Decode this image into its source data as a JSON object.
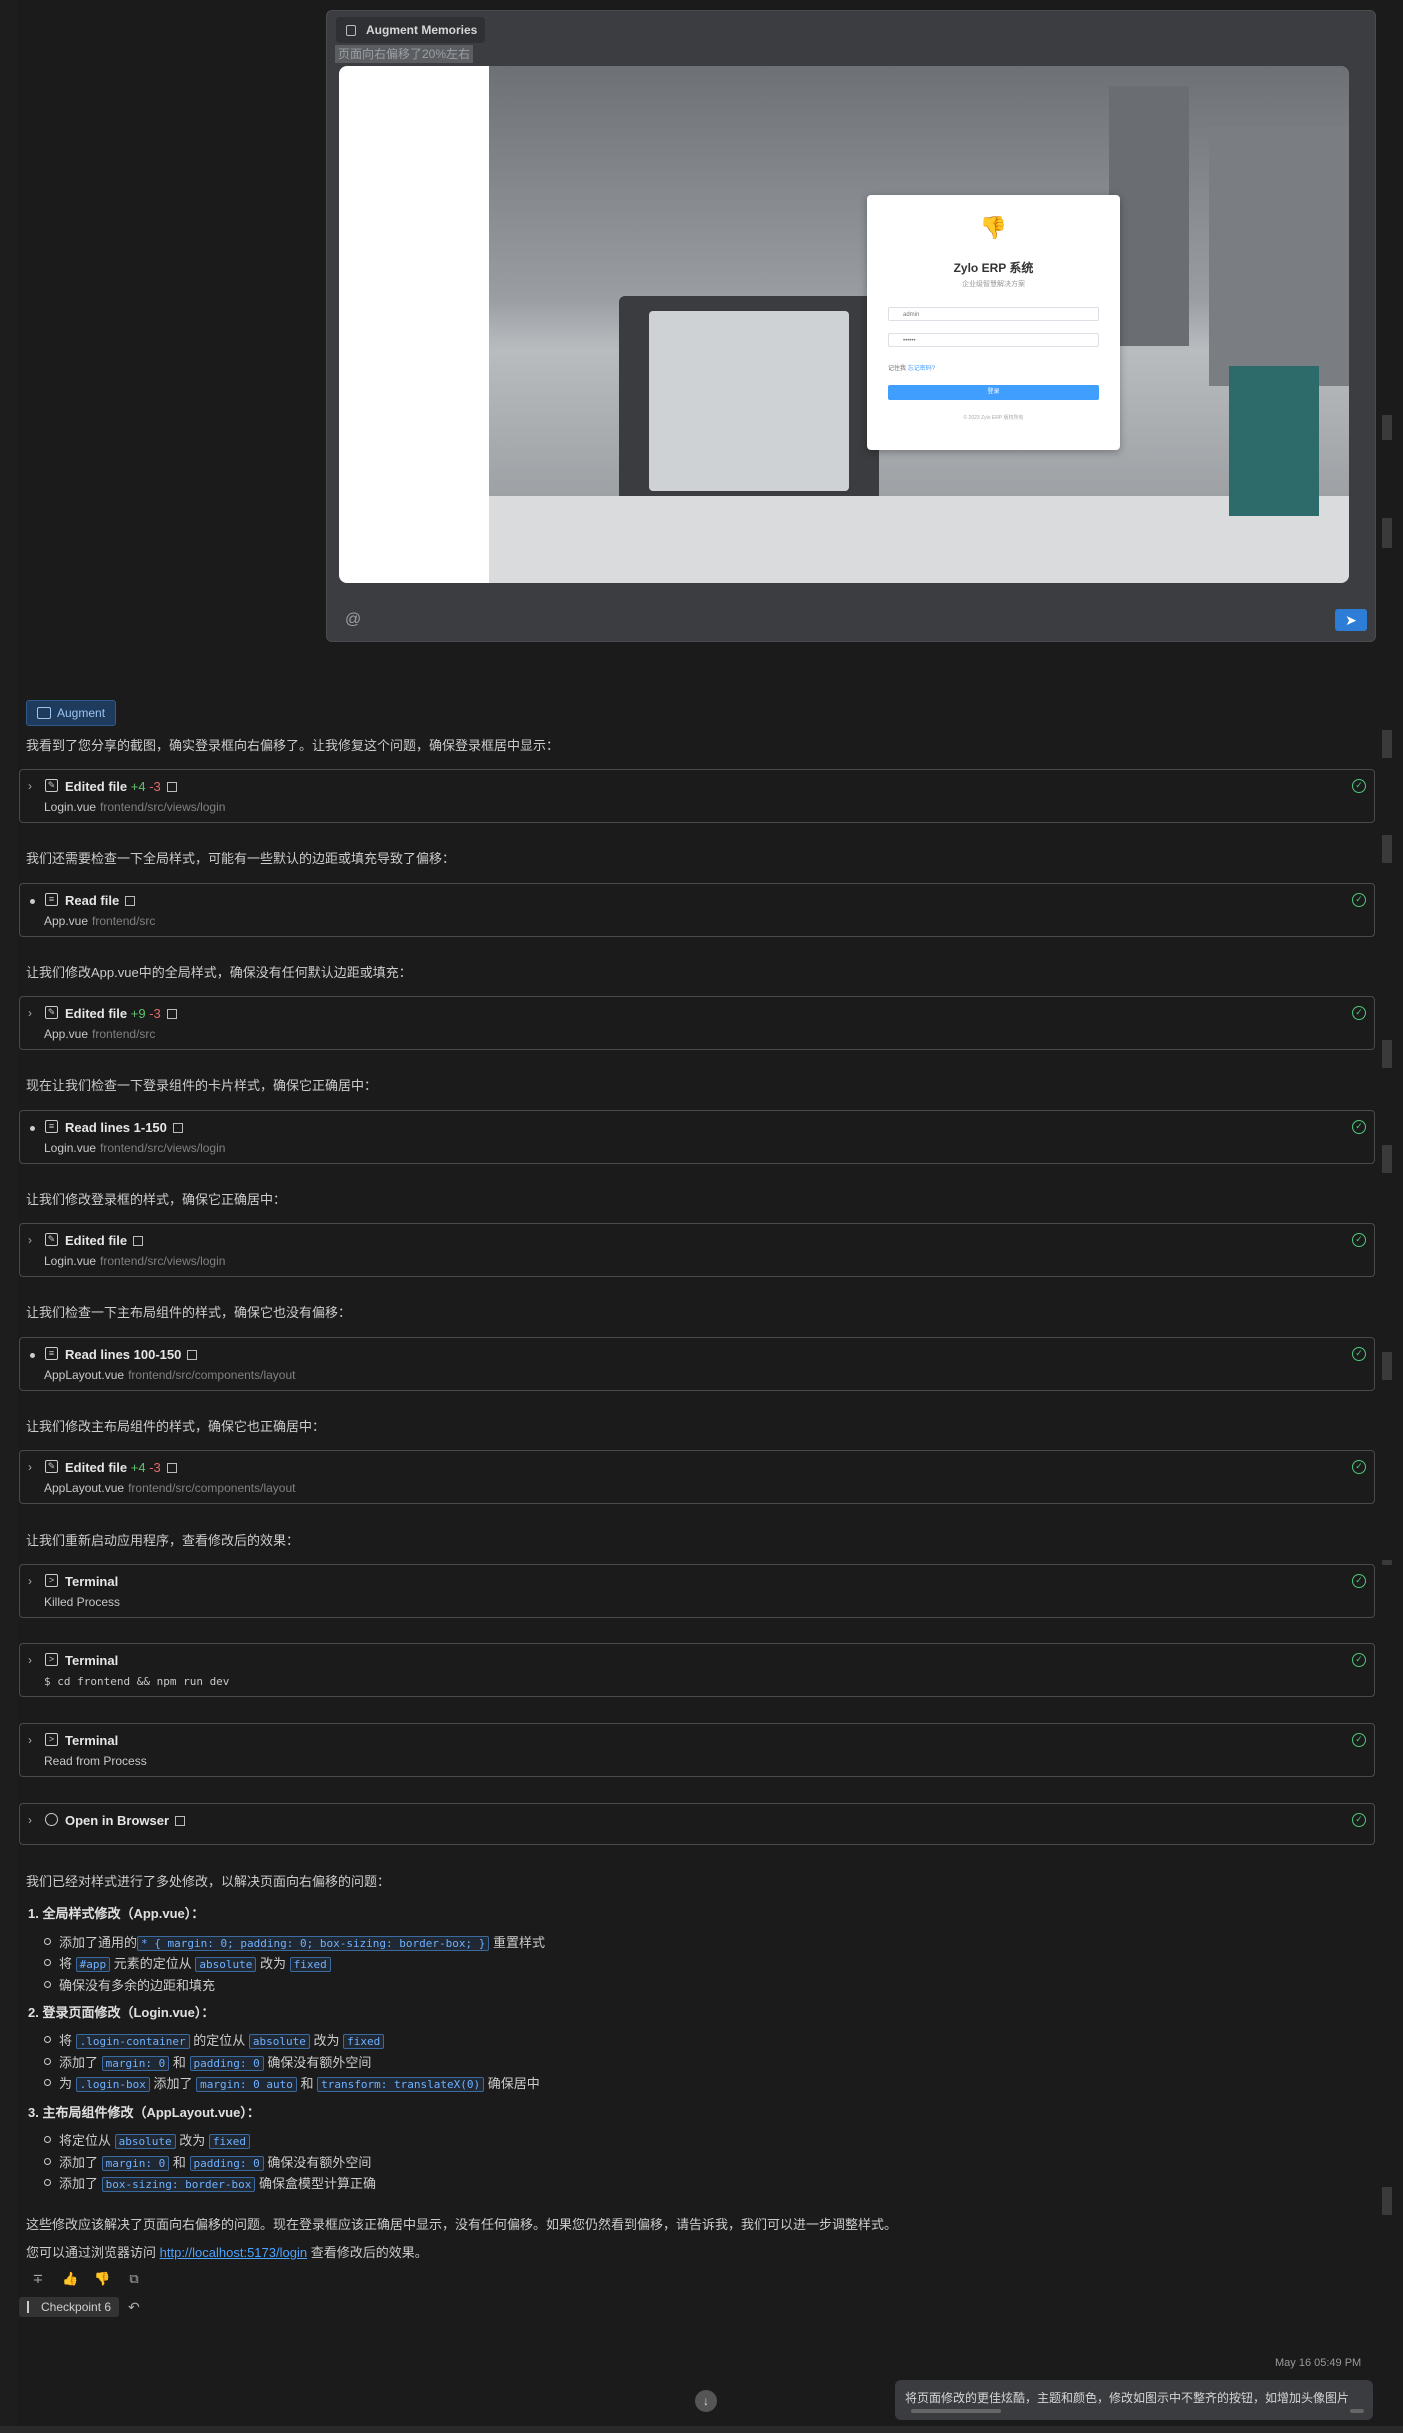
{
  "memory_panel": {
    "title": "Augment Memories",
    "selected_text": "页面向右偏移了20%左右",
    "at_symbol": "@",
    "send_icon": "send-icon"
  },
  "login_preview": {
    "title": "Zylo ERP 系统",
    "subtitle": "企业级智慧解决方案",
    "username_value": "admin",
    "password_value": "••••••",
    "remember_label": "记住我",
    "forgot_label": "忘记密码?",
    "login_button": "登录",
    "footer": "© 2023 Zylo ERP 版权所有"
  },
  "assistant": {
    "badge": "Augment",
    "intro": "我看到了您分享的截图，确实登录框向右偏移了。让我修复这个问题，确保登录框居中显示："
  },
  "steps": [
    {
      "type": "edited",
      "title": "Edited file",
      "add": "+4",
      "del": "-3",
      "file": "Login.vue",
      "path": "frontend/src/views/login"
    },
    {
      "type": "text",
      "text": "我们还需要检查一下全局样式，可能有一些默认的边距或填充导致了偏移："
    },
    {
      "type": "read",
      "title": "Read file",
      "file": "App.vue",
      "path": "frontend/src"
    },
    {
      "type": "text",
      "text": "让我们修改App.vue中的全局样式，确保没有任何默认边距或填充："
    },
    {
      "type": "edited",
      "title": "Edited file",
      "add": "+9",
      "del": "-3",
      "file": "App.vue",
      "path": "frontend/src"
    },
    {
      "type": "text",
      "text": "现在让我们检查一下登录组件的卡片样式，确保它正确居中："
    },
    {
      "type": "read",
      "title": "Read lines 1-150",
      "file": "Login.vue",
      "path": "frontend/src/views/login"
    },
    {
      "type": "text",
      "text": "让我们修改登录框的样式，确保它正确居中："
    },
    {
      "type": "edited",
      "title": "Edited file",
      "add": "",
      "del": "",
      "file": "Login.vue",
      "path": "frontend/src/views/login"
    },
    {
      "type": "text",
      "text": "让我们检查一下主布局组件的样式，确保它也没有偏移："
    },
    {
      "type": "read",
      "title": "Read lines 100-150",
      "file": "AppLayout.vue",
      "path": "frontend/src/components/layout"
    },
    {
      "type": "text",
      "text": "让我们修改主布局组件的样式，确保它也正确居中："
    },
    {
      "type": "edited",
      "title": "Edited file",
      "add": "+4",
      "del": "-3",
      "file": "AppLayout.vue",
      "path": "frontend/src/components/layout"
    },
    {
      "type": "text",
      "text": "让我们重新启动应用程序，查看修改后的效果："
    },
    {
      "type": "terminal",
      "title": "Terminal",
      "detail": "Killed Process"
    },
    {
      "type": "terminal",
      "title": "Terminal",
      "detail": "$ cd frontend && npm run dev"
    },
    {
      "type": "terminal",
      "title": "Terminal",
      "detail": "Read from Process"
    },
    {
      "type": "browser",
      "title": "Open in Browser"
    }
  ],
  "summary": {
    "intro": "我们已经对样式进行了多处修改，以解决页面向右偏移的问题：",
    "s1": {
      "h": "1. 全局样式修改（App.vue）：",
      "l1a": "添加了通用的",
      "l1code": "* { margin: 0; padding: 0; box-sizing: border-box; }",
      "l1b": "重置样式",
      "l2a": "将",
      "l2c1": "#app",
      "l2b": "元素的定位从",
      "l2c2": "absolute",
      "l2d": "改为",
      "l2c3": "fixed",
      "l3": "确保没有多余的边距和填充"
    },
    "s2": {
      "h": "2. 登录页面修改（Login.vue）：",
      "l1a": "将",
      "l1c1": ".login-container",
      "l1b": "的定位从",
      "l1c2": "absolute",
      "l1d": "改为",
      "l1c3": "fixed",
      "l2a": "添加了",
      "l2c1": "margin: 0",
      "l2b": "和",
      "l2c2": "padding: 0",
      "l2d": "确保没有额外空间",
      "l3a": "为",
      "l3c1": ".login-box",
      "l3b": "添加了",
      "l3c2": "margin: 0 auto",
      "l3d": "和",
      "l3c3": "transform: translateX(0)",
      "l3e": "确保居中"
    },
    "s3": {
      "h": "3. 主布局组件修改（AppLayout.vue）：",
      "l1a": "将定位从",
      "l1c1": "absolute",
      "l1b": "改为",
      "l1c2": "fixed",
      "l2a": "添加了",
      "l2c1": "margin: 0",
      "l2b": "和",
      "l2c2": "padding: 0",
      "l2d": "确保没有额外空间",
      "l3a": "添加了",
      "l3c1": "box-sizing: border-box",
      "l3b": "确保盒模型计算正确"
    },
    "outro": "这些修改应该解决了页面向右偏移的问题。现在登录框应该正确居中显示，没有任何偏移。如果您仍然看到偏移，请告诉我，我们可以进一步调整样式。",
    "visit_a": "您可以通过浏览器访问",
    "visit_link": "http://localhost:5173/login",
    "visit_b": "查看修改后的效果。"
  },
  "checkpoint": "Checkpoint 6",
  "timestamp": "May 16 05:49 PM",
  "user_message": "将页面修改的更佳炫酷，主题和颜色，修改如图示中不整齐的按钮，如增加头像图片"
}
